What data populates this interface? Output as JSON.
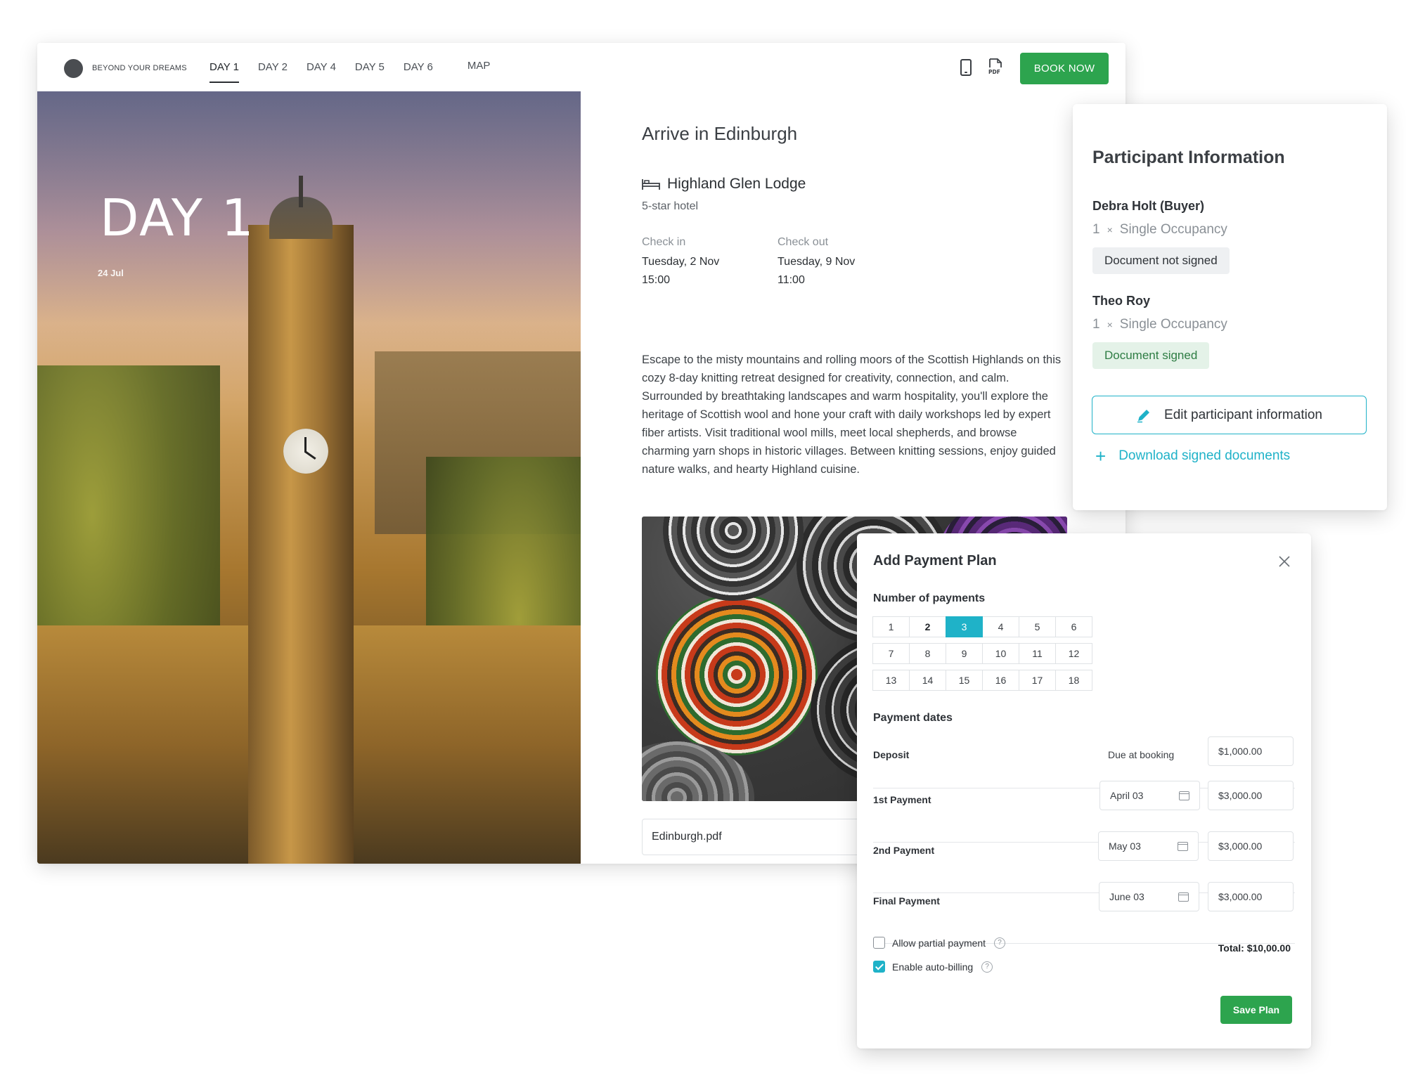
{
  "brand": {
    "name": "BEYOND YOUR DREAMS"
  },
  "nav": {
    "items": [
      {
        "label": "DAY 1",
        "active": true
      },
      {
        "label": "DAY 2",
        "active": false
      },
      {
        "label": "DAY 4",
        "active": false
      },
      {
        "label": "DAY 5",
        "active": false
      },
      {
        "label": "DAY 6",
        "active": false
      }
    ],
    "map_label": "MAP",
    "pdf_label": "PDF",
    "book_label": "BOOK NOW"
  },
  "hero": {
    "day": "DAY 1",
    "date": "24 Jul"
  },
  "day": {
    "title": "Arrive in Edinburgh",
    "hotel": {
      "name": "Highland Glen Lodge",
      "type": "5-star hotel"
    },
    "check_in": {
      "label": "Check in",
      "date": "Tuesday, 2 Nov",
      "time": "15:00"
    },
    "check_out": {
      "label": "Check out",
      "date": "Tuesday, 9 Nov",
      "time": "11:00"
    },
    "description": "Escape to the misty mountains and rolling moors of the Scottish Highlands on this cozy 8-day knitting retreat designed for creativity, connection, and calm. Surrounded by breathtaking landscapes and warm hospitality, you'll explore the heritage of Scottish wool and hone your craft with daily workshops led by expert fiber artists. Visit traditional wool mills, meet local shepherds, and browse charming yarn shops in historic villages. Between knitting sessions, enjoy guided nature walks, and hearty Highland cuisine.",
    "attachment": "Edinburgh.pdf"
  },
  "participants": {
    "title": "Participant Information",
    "people": [
      {
        "name": "Debra Holt (Buyer)",
        "qty": "1",
        "times": "×",
        "occupancy": "Single Occupancy",
        "status": "Document not signed"
      },
      {
        "name": "Theo Roy",
        "qty": "1",
        "times": "×",
        "occupancy": "Single Occupancy",
        "status": "Document signed"
      }
    ],
    "edit_label": "Edit participant information",
    "download_label": "Download signed documents"
  },
  "payment": {
    "title": "Add Payment Plan",
    "num_label": "Number of payments",
    "numbers": [
      "1",
      "2",
      "3",
      "4",
      "5",
      "6",
      "7",
      "8",
      "9",
      "10",
      "11",
      "12",
      "13",
      "14",
      "15",
      "16",
      "17",
      "18"
    ],
    "selected": "3",
    "dates_label": "Payment dates",
    "deposit": {
      "label": "Deposit",
      "due": "Due at booking",
      "amount": "$1,000.00"
    },
    "rows": [
      {
        "label": "1st Payment",
        "date": "April 03",
        "amount": "$3,000.00"
      },
      {
        "label": "2nd Payment",
        "date": "May 03",
        "amount": "$3,000.00"
      },
      {
        "label": "Final Payment",
        "date": "June 03",
        "amount": "$3,000.00"
      }
    ],
    "allow_partial": {
      "label": "Allow partial payment",
      "checked": false
    },
    "auto_billing": {
      "label": "Enable auto-billing",
      "checked": true
    },
    "help_glyph": "?",
    "total": "Total: $10,00.00",
    "save_label": "Save Plan"
  },
  "colors": {
    "accent": "#1fb2c8",
    "green": "#2da44e"
  }
}
